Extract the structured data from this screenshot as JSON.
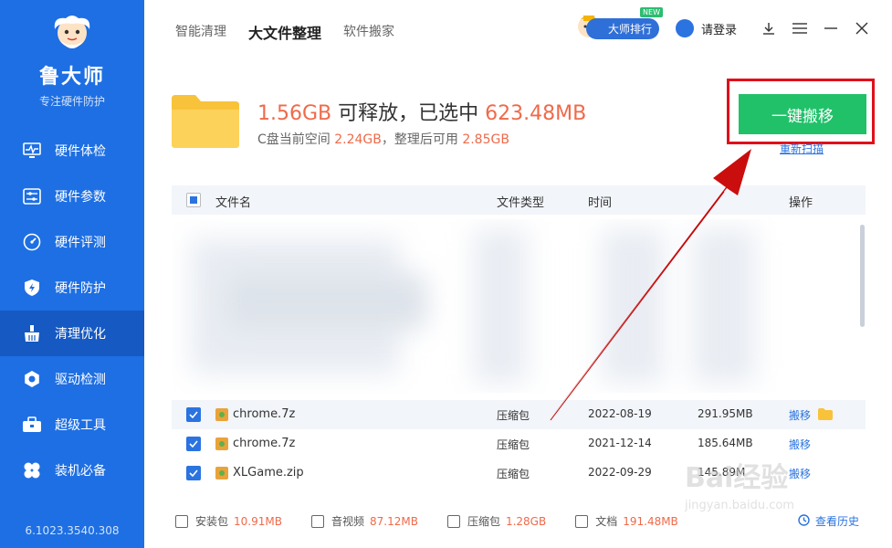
{
  "sidebar": {
    "brand": "鲁大师",
    "tagline": "专注硬件防护",
    "items": [
      {
        "label": "硬件体检",
        "icon": "monitor-pulse-icon"
      },
      {
        "label": "硬件参数",
        "icon": "sliders-icon"
      },
      {
        "label": "硬件评测",
        "icon": "gauge-icon"
      },
      {
        "label": "硬件防护",
        "icon": "shield-icon"
      },
      {
        "label": "清理优化",
        "icon": "broom-icon",
        "active": true
      },
      {
        "label": "驱动检测",
        "icon": "gear-icon"
      },
      {
        "label": "超级工具",
        "icon": "toolbox-icon"
      },
      {
        "label": "装机必备",
        "icon": "clover-icon"
      }
    ],
    "version": "6.1023.3540.308"
  },
  "topbar": {
    "tabs": [
      {
        "label": "智能清理"
      },
      {
        "label": "大文件整理",
        "active": true
      },
      {
        "label": "软件搬家"
      }
    ],
    "rank_label": "大师排行",
    "new_tag": "NEW",
    "login_label": "请登录"
  },
  "summary": {
    "releasable": "1.56GB",
    "releasable_text": "可释放，已选中",
    "selected": "623.48MB",
    "space_prefix": "C盘当前空间",
    "current_space": "2.24GB",
    "after_prefix": "，整理后可用",
    "after_space": "2.85GB",
    "move_button": "一键搬移",
    "rescan": "重新扫描"
  },
  "table": {
    "headers": {
      "name": "文件名",
      "type": "文件类型",
      "time": "时间",
      "action": "操作"
    },
    "rows": [
      {
        "name": "chrome.7z",
        "type": "压缩包",
        "time": "2022-08-19",
        "size": "291.95MB",
        "action": "搬移"
      },
      {
        "name": "chrome.7z",
        "type": "压缩包",
        "time": "2021-12-14",
        "size": "185.64MB",
        "action": "搬移"
      },
      {
        "name": "XLGame.zip",
        "type": "压缩包",
        "time": "2022-09-29",
        "size": "145.89M",
        "action": "搬移"
      }
    ]
  },
  "footer": {
    "stats": [
      {
        "label": "安装包",
        "value": "10.91MB",
        "icon": "package-icon"
      },
      {
        "label": "音视频",
        "value": "87.12MB",
        "icon": "play-icon"
      },
      {
        "label": "压缩包",
        "value": "1.28GB",
        "icon": "zip-icon"
      },
      {
        "label": "文档",
        "value": "191.48MB",
        "icon": "document-icon"
      }
    ],
    "history": "查看历史"
  },
  "watermark": {
    "brand": "Bai经验",
    "url": "jingyan.baidu.com"
  },
  "colors": {
    "sidebar": "#1e6fe3",
    "accent_orange": "#ef6a4a",
    "cta_green": "#21c16a",
    "highlight_red": "#e10f1a",
    "link_blue": "#2a73e0"
  }
}
